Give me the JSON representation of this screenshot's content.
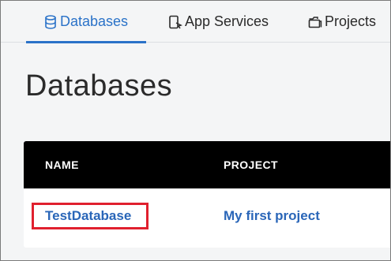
{
  "tabs": [
    {
      "label": "Databases",
      "icon": "database-icon",
      "active": true
    },
    {
      "label": "App Services",
      "icon": "app-services-icon",
      "active": false
    },
    {
      "label": "Projects",
      "icon": "folder-icon",
      "active": false
    }
  ],
  "page": {
    "title": "Databases"
  },
  "table": {
    "columns": [
      "NAME",
      "PROJECT"
    ],
    "rows": [
      {
        "name": "TestDatabase",
        "project": "My first project",
        "highlighted": true
      }
    ]
  },
  "colors": {
    "accent": "#2a72c8",
    "link": "#2a66b8",
    "highlight": "#e0202e",
    "header_bg": "#000000"
  }
}
